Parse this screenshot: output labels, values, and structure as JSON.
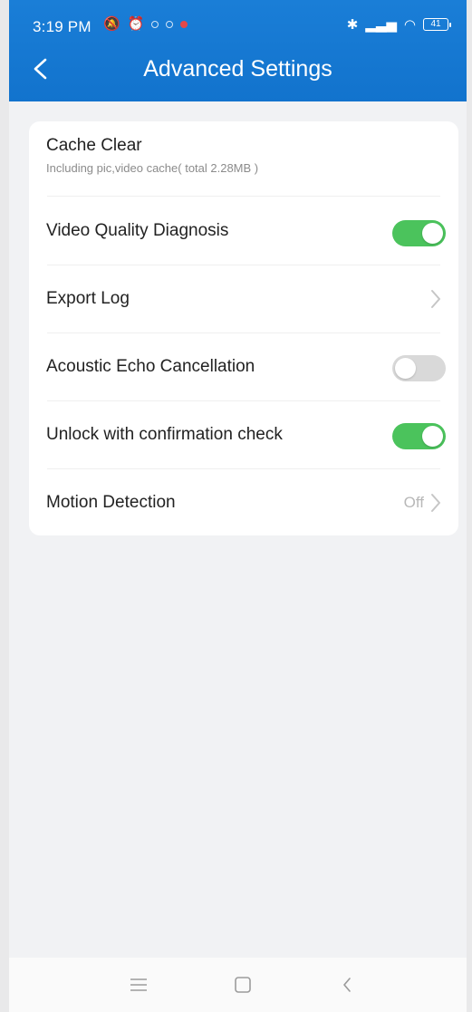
{
  "status_bar": {
    "time": "3:19 PM",
    "battery": "41",
    "icons": [
      "silent-icon",
      "alarm-icon",
      "notification-dot-icon",
      "notification-dot-icon",
      "notification-dot-icon",
      "bluetooth-icon",
      "signal-icon",
      "wifi-icon",
      "battery-icon"
    ]
  },
  "header": {
    "title": "Advanced Settings",
    "back_icon": "back-arrow-icon"
  },
  "colors": {
    "header_blue": "#1677d2",
    "toggle_on": "#4bc35c",
    "toggle_off": "#d9d9d9",
    "background": "#f1f2f4"
  },
  "settings": {
    "cache_clear": {
      "label": "Cache Clear",
      "description": "Including pic,video cache( total 2.28MB )"
    },
    "video_quality_diagnosis": {
      "label": "Video Quality Diagnosis",
      "state": "on"
    },
    "export_log": {
      "label": "Export Log"
    },
    "acoustic_echo_cancellation": {
      "label": "Acoustic Echo Cancellation",
      "state": "off"
    },
    "unlock_confirmation": {
      "label": "Unlock with confirmation check",
      "state": "on"
    },
    "motion_detection": {
      "label": "Motion Detection",
      "value": "Off"
    }
  },
  "navigation": {
    "items": [
      "menu-icon",
      "home-icon",
      "back-icon"
    ]
  }
}
